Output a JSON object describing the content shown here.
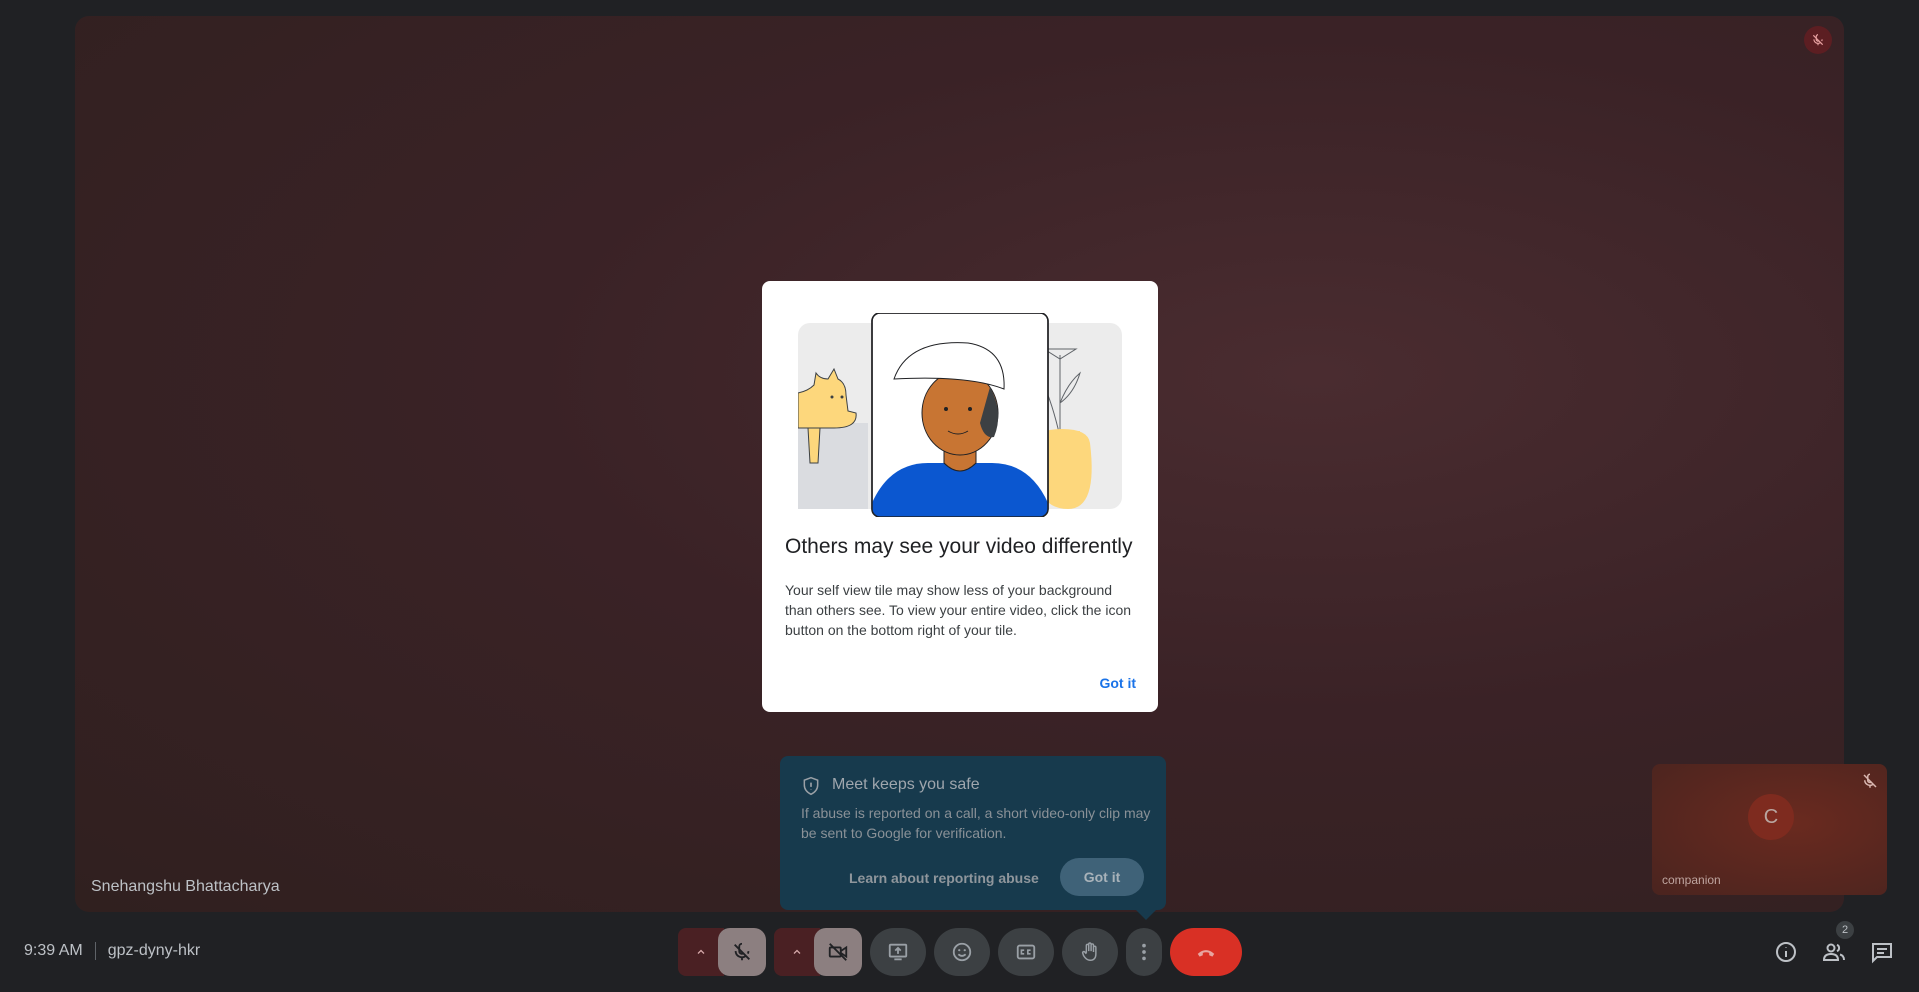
{
  "main_tile": {
    "participant_name": "Snehangshu Bhattacharya",
    "mute_icon": "mic-off-icon"
  },
  "dialog": {
    "title": "Others may see your video differently",
    "body": "Your self view tile may show less of your background than others see. To view your entire video, click the icon button on the bottom right of your tile.",
    "button": "Got it"
  },
  "safety": {
    "title": "Meet keeps you safe",
    "body": "If abuse is reported on a call, a short video-only clip may be sent to Google for verification.",
    "link": "Learn about reporting abuse",
    "button": "Got it",
    "icon": "shield-icon"
  },
  "companion": {
    "initial": "C",
    "name": "companion",
    "avatar_color": "#7e2b1f"
  },
  "meeting": {
    "time": "9:39 AM",
    "code": "gpz-dyny-hkr"
  },
  "people": {
    "count": "2"
  },
  "colors": {
    "end_call": "#d93025",
    "accent": "#1a73e8"
  }
}
